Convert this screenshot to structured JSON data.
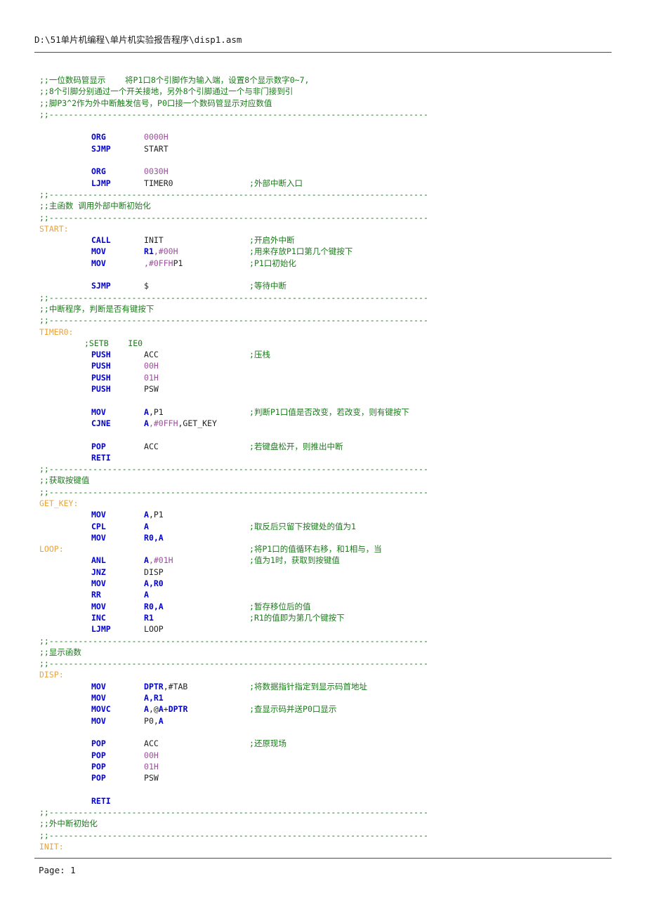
{
  "document": {
    "header_path": "D:\\51单片机编程\\单片机实验报告程序\\disp1.asm",
    "footer": "Page: 1",
    "page_number": "1",
    "file_name": "disp1.asm"
  },
  "colors": {
    "comment": "#1a7a1a",
    "label": "#e8a33d",
    "mnemonic": "#0000d4",
    "register": "#0000d4",
    "number": "#9b4f9b",
    "identifier": "#222222",
    "background": "#ffffff",
    "rule": "#4d4d4d"
  },
  "separators": {
    "dashes": ";;------------------------------------------------------------------------------"
  },
  "code": {
    "lines": [
      {
        "id": "l001",
        "kind": "comment",
        "text": ";;一位数码管显示    将P1口8个引脚作为输入端，设置8个显示数字0~7,"
      },
      {
        "id": "l002",
        "kind": "comment",
        "text": ";;8个引脚分别通过一个开关接地，另外8个引脚通过一个与非门接到引"
      },
      {
        "id": "l003",
        "kind": "comment",
        "text": ";;脚P3^2作为外中断触发信号，P0口接一个数码管显示对应数值"
      },
      {
        "id": "l004",
        "kind": "separator",
        "text": ";;------------------------------------------------------------------------------"
      },
      {
        "id": "l005",
        "kind": "blank",
        "text": ""
      },
      {
        "id": "l006",
        "kind": "instruction",
        "mnemonic": "ORG",
        "operand_num": "0000H"
      },
      {
        "id": "l007",
        "kind": "instruction",
        "mnemonic": "SJMP",
        "operand_id": "START"
      },
      {
        "id": "l008",
        "kind": "blank",
        "text": ""
      },
      {
        "id": "l009",
        "kind": "instruction",
        "mnemonic": "ORG",
        "operand_num": "0030H"
      },
      {
        "id": "l010",
        "kind": "instruction",
        "mnemonic": "LJMP",
        "operand_id": "TIMER0",
        "comment": ";外部中断入口"
      },
      {
        "id": "l011",
        "kind": "separator",
        "text": ";;------------------------------------------------------------------------------"
      },
      {
        "id": "l012",
        "kind": "comment",
        "text": ";;主函数 调用外部中断初始化"
      },
      {
        "id": "l013",
        "kind": "separator",
        "text": ";;------------------------------------------------------------------------------"
      },
      {
        "id": "l014",
        "kind": "label",
        "text": "START:"
      },
      {
        "id": "l015",
        "kind": "instruction",
        "mnemonic": "CALL",
        "operand_id": "INIT",
        "comment": ";开启外中断"
      },
      {
        "id": "l016",
        "kind": "instruction",
        "mnemonic": "MOV",
        "operand_reg": "R1",
        "operand_rest_num": ",#00H",
        "comment": ";用来存放P1口第几个键按下"
      },
      {
        "id": "l017",
        "kind": "instruction",
        "mnemonic": "MOV",
        "operand_id": "P1",
        "operand_rest_num": ",#0FFH",
        "comment": ";P1口初始化"
      },
      {
        "id": "l018",
        "kind": "blank",
        "text": ""
      },
      {
        "id": "l019",
        "kind": "instruction",
        "mnemonic": "SJMP",
        "operand_id": "$",
        "comment": ";等待中断"
      },
      {
        "id": "l020",
        "kind": "separator",
        "text": ";;------------------------------------------------------------------------------"
      },
      {
        "id": "l021",
        "kind": "comment",
        "text": ";;中断程序，判断是否有键按下"
      },
      {
        "id": "l022",
        "kind": "separator",
        "text": ";;------------------------------------------------------------------------------"
      },
      {
        "id": "l023",
        "kind": "label",
        "text": "TIMER0:"
      },
      {
        "id": "l024",
        "kind": "comment_indent",
        "text": ";SETB    IE0"
      },
      {
        "id": "l025",
        "kind": "instruction",
        "mnemonic": "PUSH",
        "operand_id": "ACC",
        "comment": ";压栈"
      },
      {
        "id": "l026",
        "kind": "instruction",
        "mnemonic": "PUSH",
        "operand_num": "00H"
      },
      {
        "id": "l027",
        "kind": "instruction",
        "mnemonic": "PUSH",
        "operand_num": "01H"
      },
      {
        "id": "l028",
        "kind": "instruction",
        "mnemonic": "PUSH",
        "operand_id": "PSW"
      },
      {
        "id": "l029",
        "kind": "blank",
        "text": ""
      },
      {
        "id": "l030",
        "kind": "instruction",
        "mnemonic": "MOV",
        "operand_reg": "A",
        "operand_rest_id": ",P1",
        "comment": ";判断P1口值是否改变，若改变，则有键按下"
      },
      {
        "id": "l031",
        "kind": "instruction",
        "mnemonic": "CJNE",
        "operand_reg": "A",
        "operand_rest_num": ",#0FFH",
        "operand_rest_id": ",GET_KEY"
      },
      {
        "id": "l032",
        "kind": "blank",
        "text": ""
      },
      {
        "id": "l033",
        "kind": "instruction",
        "mnemonic": "POP",
        "operand_id": "ACC",
        "comment": ";若键盘松开，则推出中断"
      },
      {
        "id": "l034",
        "kind": "instruction",
        "mnemonic": "RETI"
      },
      {
        "id": "l035",
        "kind": "separator",
        "text": ";;------------------------------------------------------------------------------"
      },
      {
        "id": "l036",
        "kind": "comment",
        "text": ";;获取按键值"
      },
      {
        "id": "l037",
        "kind": "separator",
        "text": ";;------------------------------------------------------------------------------"
      },
      {
        "id": "l038",
        "kind": "label",
        "text": "GET_KEY:"
      },
      {
        "id": "l039",
        "kind": "instruction",
        "mnemonic": "MOV",
        "operand_reg": "A",
        "operand_rest_id": ",P1"
      },
      {
        "id": "l040",
        "kind": "instruction",
        "mnemonic": "CPL",
        "operand_reg": "A",
        "comment": ";取反后只留下按键处的值为1"
      },
      {
        "id": "l041",
        "kind": "instruction",
        "mnemonic": "MOV",
        "operand_reg": "R0,A"
      },
      {
        "id": "l042",
        "kind": "label_comment",
        "text": "LOOP:",
        "comment": ";将P1口的值循环右移，和1相与，当"
      },
      {
        "id": "l043",
        "kind": "instruction",
        "mnemonic": "ANL",
        "operand_reg": "A",
        "operand_rest_num": ",#01H",
        "comment": ";值为1时，获取到按键值"
      },
      {
        "id": "l044",
        "kind": "instruction",
        "mnemonic": "JNZ",
        "operand_id": "DISP"
      },
      {
        "id": "l045",
        "kind": "instruction",
        "mnemonic": "MOV",
        "operand_reg": "A,R0"
      },
      {
        "id": "l046",
        "kind": "instruction",
        "mnemonic": "RR",
        "operand_reg": "A"
      },
      {
        "id": "l047",
        "kind": "instruction",
        "mnemonic": "MOV",
        "operand_reg": "R0,A",
        "comment": ";暂存移位后的值"
      },
      {
        "id": "l048",
        "kind": "instruction",
        "mnemonic": "INC",
        "operand_reg": "R1",
        "comment": ";R1的值即为第几个键按下"
      },
      {
        "id": "l049",
        "kind": "instruction",
        "mnemonic": "LJMP",
        "operand_id": "LOOP"
      },
      {
        "id": "l050",
        "kind": "separator",
        "text": ";;------------------------------------------------------------------------------"
      },
      {
        "id": "l051",
        "kind": "comment",
        "text": ";;显示函数"
      },
      {
        "id": "l052",
        "kind": "separator",
        "text": ";;------------------------------------------------------------------------------"
      },
      {
        "id": "l053",
        "kind": "label",
        "text": "DISP:"
      },
      {
        "id": "l054",
        "kind": "instruction",
        "mnemonic": "MOV",
        "operand_reg": "DPTR",
        "operand_rest_id": ",#TAB",
        "comment": ";将数据指针指定到显示码首地址"
      },
      {
        "id": "l055",
        "kind": "instruction",
        "mnemonic": "MOV",
        "operand_reg": "A,R1"
      },
      {
        "id": "l056",
        "kind": "instruction",
        "mnemonic": "MOVC",
        "operand_mixed": "A,@A+DPTR",
        "comment": ";查显示码并送P0口显示"
      },
      {
        "id": "l057",
        "kind": "instruction",
        "mnemonic": "MOV",
        "operand_id": "P0,",
        "operand_reg_tail": "A"
      },
      {
        "id": "l058",
        "kind": "blank",
        "text": ""
      },
      {
        "id": "l059",
        "kind": "instruction",
        "mnemonic": "POP",
        "operand_id": "ACC",
        "comment": ";还原现场"
      },
      {
        "id": "l060",
        "kind": "instruction",
        "mnemonic": "POP",
        "operand_num": "00H"
      },
      {
        "id": "l061",
        "kind": "instruction",
        "mnemonic": "POP",
        "operand_num": "01H"
      },
      {
        "id": "l062",
        "kind": "instruction",
        "mnemonic": "POP",
        "operand_id": "PSW"
      },
      {
        "id": "l063",
        "kind": "blank",
        "text": ""
      },
      {
        "id": "l064",
        "kind": "instruction",
        "mnemonic": "RETI"
      },
      {
        "id": "l065",
        "kind": "separator",
        "text": ";;------------------------------------------------------------------------------"
      },
      {
        "id": "l066",
        "kind": "comment",
        "text": ";;外中断初始化"
      },
      {
        "id": "l067",
        "kind": "separator",
        "text": ";;------------------------------------------------------------------------------"
      },
      {
        "id": "l068",
        "kind": "label",
        "text": "INIT:"
      }
    ]
  }
}
